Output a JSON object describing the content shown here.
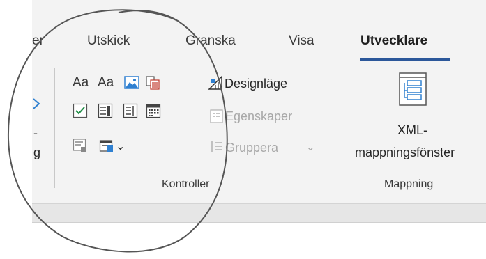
{
  "tabs": [
    {
      "label": "er"
    },
    {
      "label": "Utskick"
    },
    {
      "label": "Granska"
    },
    {
      "label": "Visa"
    },
    {
      "label": "Utvecklare",
      "active": true
    }
  ],
  "left_fragments": {
    "dash": "-",
    "g": "g"
  },
  "controls": {
    "text_aa_1": "Aa",
    "text_aa_2": "Aa",
    "design_mode": "Designläge",
    "properties": "Egenskaper",
    "group": "Gruppera",
    "group_chevron": "⌄",
    "legacy_chevron": "⌄",
    "group_label": "Kontroller"
  },
  "mapping": {
    "xml_line1": "XML-",
    "xml_line2": "mappningsfönster",
    "group_label": "Mappning"
  },
  "colors": {
    "accent": "#2b579a",
    "checkbox_green": "#1e8c45",
    "picture_blue": "#2f80d1",
    "disabled_text": "#a8a8a8"
  }
}
